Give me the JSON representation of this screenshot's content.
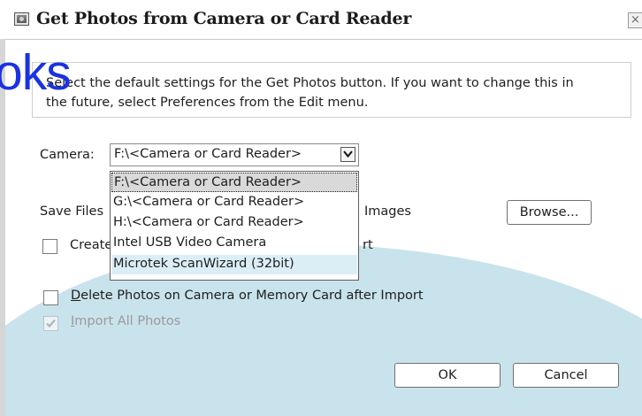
{
  "dialog": {
    "title": "Get Photos from Camera or Card Reader",
    "close_glyph": "×"
  },
  "watermark": {
    "text": "oks"
  },
  "info": {
    "line1": "Select the default settings for the Get Photos button. If you want to change this in",
    "line2": "the future, select Preferences from the Edit menu."
  },
  "camera": {
    "label": "Camera:",
    "selected_value": "F:\\<Camera or Card Reader>",
    "options": [
      "F:\\<Camera or Card Reader>",
      "G:\\<Camera or Card Reader>",
      "H:\\<Camera or Card Reader>",
      "Intel USB Video Camera",
      "Microtek ScanWizard (32bit)"
    ]
  },
  "save_files": {
    "label": "Save Files",
    "trailing_text": "Images",
    "browse_label": "Browse..."
  },
  "create_option": {
    "label_start": "Create",
    "label_end": "rt",
    "checked": false
  },
  "delete_option": {
    "first_letter": "D",
    "label_rest": "elete Photos on Camera or Memory Card after Import",
    "checked": false
  },
  "import_all": {
    "first_letter": "I",
    "label_rest": "mport All Photos",
    "checked": true,
    "enabled": false
  },
  "buttons": {
    "ok": "OK",
    "cancel": "Cancel"
  },
  "colors": {
    "accent_bg": "#c9e3ec",
    "watermark": "#1b32e0",
    "dropdown_hover": "#dbeef6"
  },
  "icons": [
    "app-icon",
    "close-icon",
    "chevron-down-icon",
    "checkmark-icon"
  ]
}
